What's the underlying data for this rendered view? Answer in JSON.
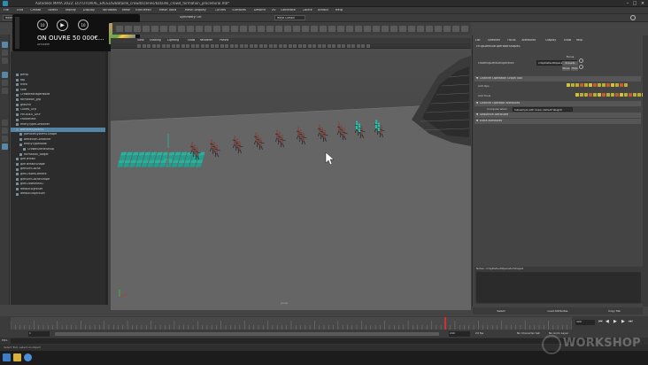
{
  "window": {
    "title": "Autodesk MAYA 2022: D:/TUTORIAL_EXCELIS/Bataille_crowd/scenes/bataille_crowd_formation_procedural.mb*"
  },
  "menus": [
    "File",
    "Edit",
    "Create",
    "Select",
    "Modify",
    "Display",
    "Windows",
    "Mesh",
    "Edit Mesh",
    "Mesh Tools",
    "Mesh Display",
    "Curves",
    "Surfaces",
    "Deform",
    "UV",
    "Generate",
    "Cache",
    "Arnold",
    "Help"
  ],
  "statusline": {
    "mode": "Modeling",
    "symmetry": "Symmetry: Off",
    "workspace": "Maya Classic"
  },
  "media": {
    "title": "ON OUVRE 50 000€...",
    "source": "Amixem",
    "side_icon": "volume-icon",
    "controls": [
      {
        "name": "rewind-10-button",
        "label": "10"
      },
      {
        "name": "play-button",
        "label": "▶"
      },
      {
        "name": "forward-10-button",
        "label": "10"
      }
    ]
  },
  "outliner": {
    "rows": [
      {
        "label": "persp",
        "depth": 0,
        "selected": false
      },
      {
        "label": "top",
        "depth": 0,
        "selected": false
      },
      {
        "label": "front",
        "depth": 0,
        "selected": false
      },
      {
        "label": "side",
        "depth": 0,
        "selected": false
      },
      {
        "label": "CrowdManagerNode",
        "depth": 0,
        "selected": false
      },
      {
        "label": "formation_grp",
        "depth": 0,
        "selected": false
      },
      {
        "label": "ground",
        "depth": 0,
        "selected": false
      },
      {
        "label": "Cubes_Grp",
        "depth": 0,
        "selected": false
      },
      {
        "label": "PROXIES_GRP",
        "depth": 0,
        "selected": false
      },
      {
        "label": "crowdField",
        "depth": 0,
        "selected": false
      },
      {
        "label": "entityTypeContainer",
        "depth": 0,
        "selected": false
      },
      {
        "label": "particleSystem1",
        "depth": 0,
        "selected": true
      },
      {
        "label": "particleSystem1Shape",
        "depth": 1,
        "selected": false
      },
      {
        "label": "behaviorContainer",
        "depth": 1,
        "selected": false
      },
      {
        "label": "entityTypeNode",
        "depth": 1,
        "selected": false
      },
      {
        "label": "CrowdSceneSetup",
        "depth": 2,
        "selected": false
      },
      {
        "label": "formation_target",
        "depth": 1,
        "selected": false
      },
      {
        "label": "glmTerrain",
        "depth": 0,
        "selected": false
      },
      {
        "label": "glmTerrainShape",
        "depth": 0,
        "selected": false
      },
      {
        "label": "glmSimCache",
        "depth": 0,
        "selected": false
      },
      {
        "label": "glmCrowdCamera",
        "depth": 0,
        "selected": false
      },
      {
        "label": "glmSimCacheShape",
        "depth": 0,
        "selected": false
      },
      {
        "label": "glmCrowdField1",
        "depth": 0,
        "selected": false
      },
      {
        "label": "defaultLightSet",
        "depth": 0,
        "selected": false
      },
      {
        "label": "defaultObjectSet",
        "depth": 0,
        "selected": false
      }
    ]
  },
  "viewport": {
    "menus": [
      "View",
      "Shading",
      "Lighting",
      "Show",
      "Renderer",
      "Panels"
    ],
    "camera_label": "persp"
  },
  "attribute_editor": {
    "menus": [
      "List",
      "Selected",
      "Focus",
      "Attributes",
      "Display",
      "Show",
      "Help"
    ],
    "tab": "crOpDefaultOperatorShape1",
    "node_label": "crowdOpDefaultOperator:",
    "node_value": "crOpDefaultOperatorShape1",
    "focus_label": "Focus",
    "presets_label": "Presets",
    "show_label": "Show",
    "hide_label": "Hide",
    "sections": [
      {
        "label": "Channel Operation Graph Tool"
      },
      {
        "label": "Channel Operator Attributes"
      },
      {
        "label": "Sequence Attributes"
      },
      {
        "label": "Extra Attributes"
      }
    ],
    "add_row_labels": [
      "Add Ops",
      "Add Tools"
    ],
    "dropdown_label": "Compute when",
    "dropdown_value": "Subsample with Scale (default Weight)",
    "notes_title": "Notes: crOpDefaultOperatorShape1",
    "buttons": [
      "Select",
      "Load Attributes",
      "Copy Tab"
    ]
  },
  "timeline": {
    "start": "1",
    "end": "240",
    "current": "300",
    "fps": "24 fps",
    "character_set": "No Character Set",
    "anim_layer": "No Anim Layer"
  },
  "mel": {
    "label": "MEL"
  },
  "status_message": "Select Tool: select an object",
  "watermark": {
    "text": "WORKSHOP"
  },
  "colors": {
    "selection": "#5285a6",
    "agent_body": "#7a4a45",
    "agent_highlight": "#1fc7b0",
    "ground": "#6a6a6a"
  }
}
